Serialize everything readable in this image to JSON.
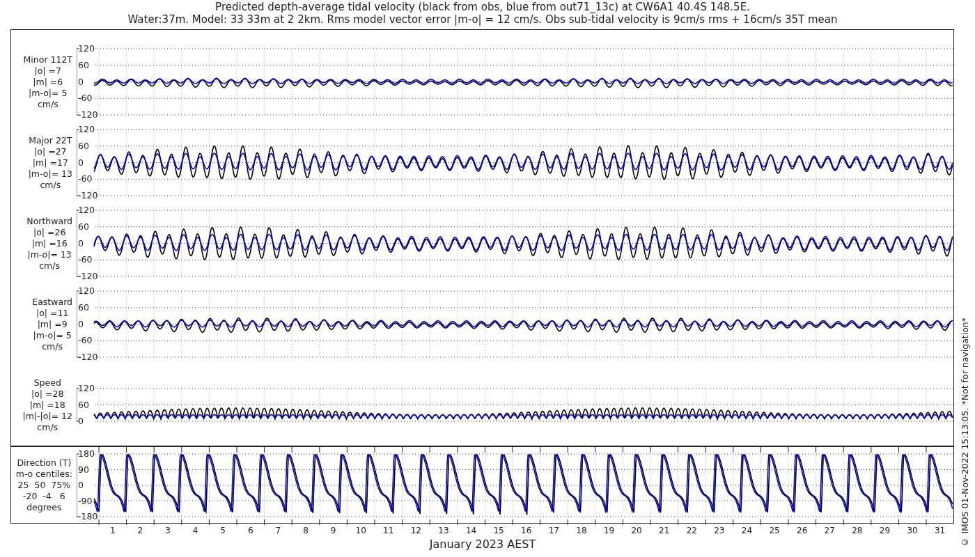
{
  "title": [
    "Predicted depth-average tidal velocity (black from obs, blue from out71_13c) at CW6A1 40.4S 148.5E.",
    "Water:37m. Model: 33 33m at 2 2km. Rms model vector error |m-o| = 12 cm/s. Obs sub-tidal velocity is 9cm/s rms + 16cm/s 35T mean"
  ],
  "panels": [
    {
      "kind": "signed",
      "label_lines": [
        "Minor 112T",
        "|o| =7",
        "|m| =6",
        "|m-o|= 5",
        "cm/s"
      ],
      "yticks": [
        "120",
        "60",
        "0",
        "-60",
        "-120"
      ]
    },
    {
      "kind": "signed",
      "label_lines": [
        "Major 22T",
        "|o| =27",
        "|m| =17",
        "|m-o|= 13",
        "cm/s"
      ],
      "yticks": [
        "120",
        "60",
        "0",
        "-60",
        "-120"
      ]
    },
    {
      "kind": "signed",
      "label_lines": [
        "Northward",
        "|o| =26",
        "|m| =16",
        "|m-o|= 13",
        "cm/s"
      ],
      "yticks": [
        "120",
        "60",
        "0",
        "-60",
        "-120"
      ]
    },
    {
      "kind": "signed",
      "label_lines": [
        "Eastward",
        "|o| =11",
        "|m| =9",
        "|m-o|= 5",
        "cm/s"
      ],
      "yticks": [
        "120",
        "60",
        "0",
        "-60",
        "-120"
      ]
    },
    {
      "kind": "speed",
      "label_lines": [
        "Speed",
        "|o| =28",
        "|m| =18",
        "|m|-|o|= 12",
        "cm/s"
      ],
      "yticks": [
        "120",
        "60",
        "0"
      ]
    },
    {
      "kind": "direction",
      "label_lines": [
        "Direction (T)",
        "m-o centiles:",
        "25  50  75%",
        "-20  -4   6",
        "degrees"
      ],
      "yticks": [
        "180",
        "90",
        "0",
        "-90",
        "-180"
      ]
    }
  ],
  "xaxis": {
    "ticks": [
      "1",
      "2",
      "3",
      "4",
      "5",
      "6",
      "7",
      "8",
      "9",
      "10",
      "11",
      "12",
      "13",
      "14",
      "15",
      "16",
      "17",
      "18",
      "19",
      "20",
      "21",
      "22",
      "23",
      "24",
      "25",
      "26",
      "27",
      "28",
      "29",
      "30",
      "31"
    ],
    "label": "January 2023 AEST"
  },
  "side_note": "© IMOS 01-Nov-2022 15:13:05. *Not for navigation*"
}
